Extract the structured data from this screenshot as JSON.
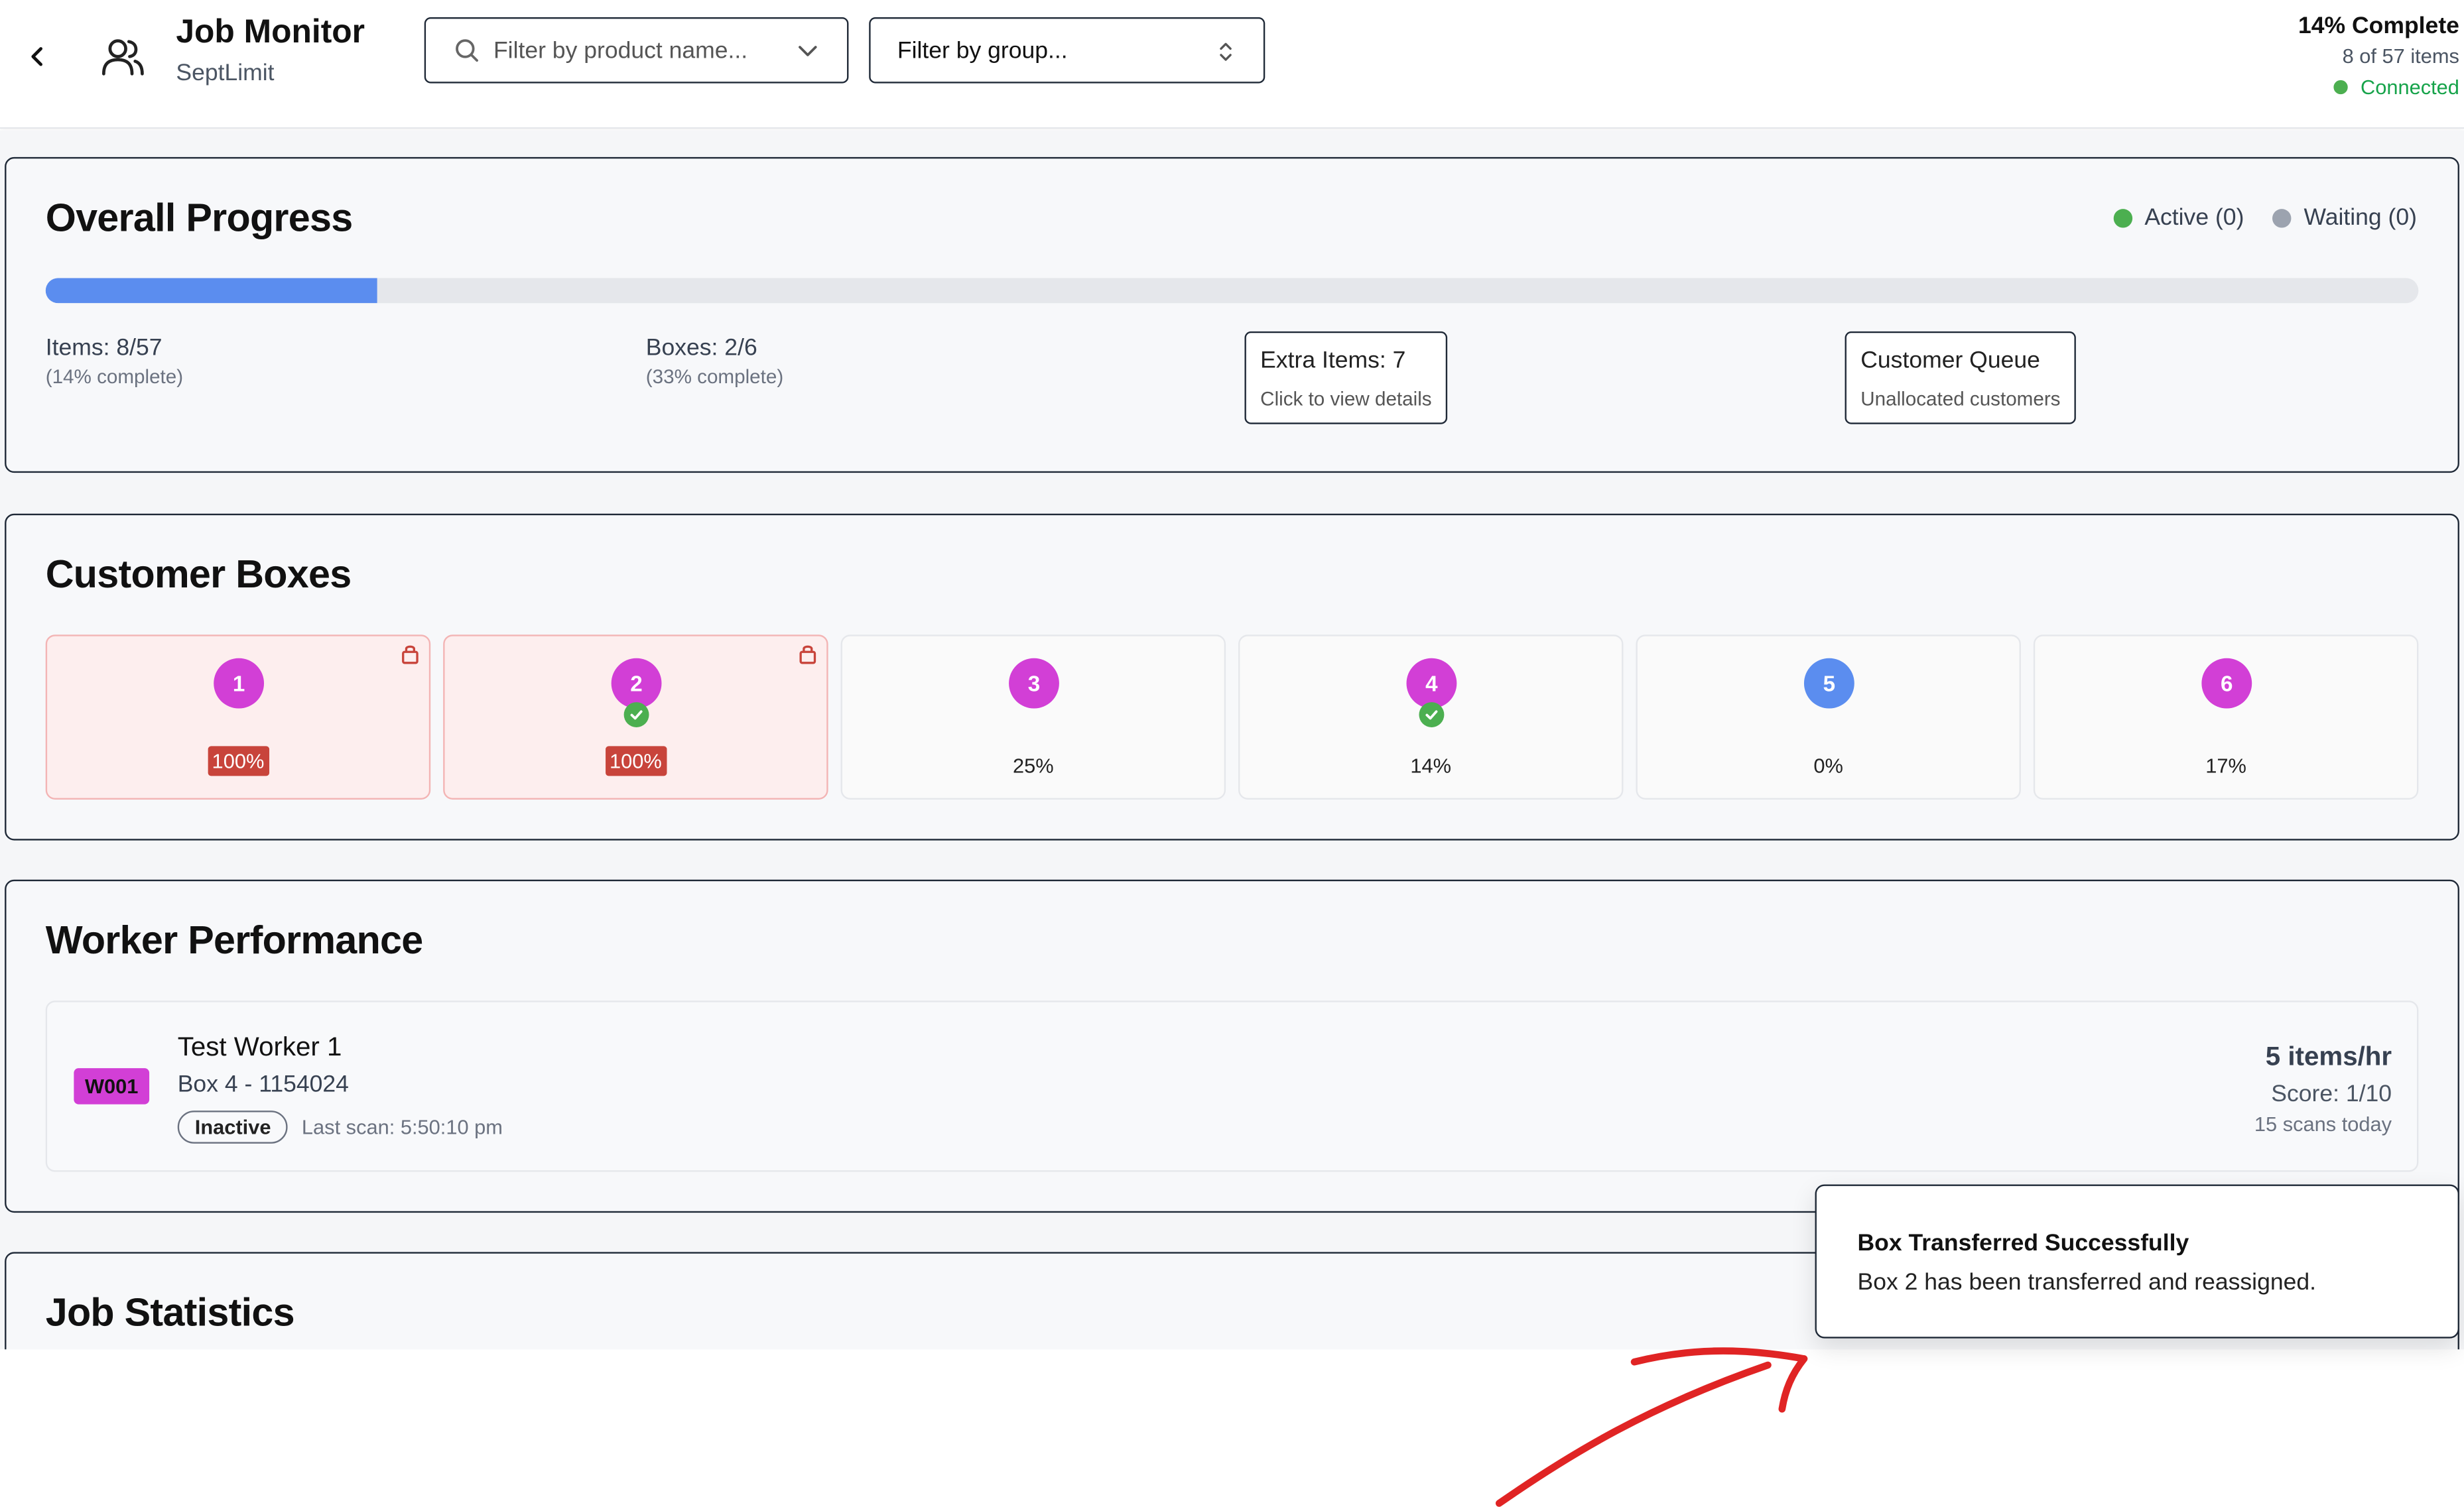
{
  "header": {
    "title": "Job Monitor",
    "subtitle": "SeptLimit",
    "product_filter_placeholder": "Filter by product name...",
    "group_filter_placeholder": "Filter by group...",
    "completion": "14% Complete",
    "items_count": "8 of 57 items",
    "connection": "Connected",
    "connection_color": "#4caf50"
  },
  "overall": {
    "title": "Overall Progress",
    "legend_active": "Active (0)",
    "legend_waiting": "Waiting (0)",
    "active_color": "#4caf50",
    "waiting_color": "#9ca3af",
    "progress_fraction": 0.14,
    "items_label": "Items: 8/57",
    "items_sub": "(14% complete)",
    "boxes_label": "Boxes: 2/6",
    "boxes_sub": "(33% complete)",
    "extra_label": "Extra Items: 7",
    "extra_sub": "Click to view details",
    "queue_label": "Customer Queue",
    "queue_sub": "Unallocated customers"
  },
  "boxes": {
    "title": "Customer Boxes",
    "items": [
      {
        "number": "1",
        "percent": "100%",
        "full": true,
        "locked": true,
        "checked": false,
        "color": "#d23fd6"
      },
      {
        "number": "2",
        "percent": "100%",
        "full": true,
        "locked": true,
        "checked": true,
        "color": "#d23fd6"
      },
      {
        "number": "3",
        "percent": "25%",
        "full": false,
        "locked": false,
        "checked": false,
        "color": "#d23fd6"
      },
      {
        "number": "4",
        "percent": "14%",
        "full": false,
        "locked": false,
        "checked": true,
        "color": "#d23fd6"
      },
      {
        "number": "5",
        "percent": "0%",
        "full": false,
        "locked": false,
        "checked": false,
        "color": "#5b8def"
      },
      {
        "number": "6",
        "percent": "17%",
        "full": false,
        "locked": false,
        "checked": false,
        "color": "#d23fd6"
      }
    ]
  },
  "workers": {
    "title": "Worker Performance",
    "rows": [
      {
        "id": "W001",
        "name": "Test Worker 1",
        "box": "Box 4 - 1154024",
        "status": "Inactive",
        "last_scan": "Last scan: 5:50:10 pm",
        "rate": "5 items/hr",
        "score": "Score: 1/10",
        "scans": "15 scans today"
      }
    ]
  },
  "stats": {
    "title": "Job Statistics"
  },
  "toast": {
    "title": "Box Transferred Successfully",
    "description": "Box 2 has been transferred and reassigned."
  },
  "colors": {
    "accent_blue": "#5b8def",
    "box_purple": "#d23fd6",
    "alert_red": "#c8443b",
    "annotation_red": "#e02424"
  }
}
